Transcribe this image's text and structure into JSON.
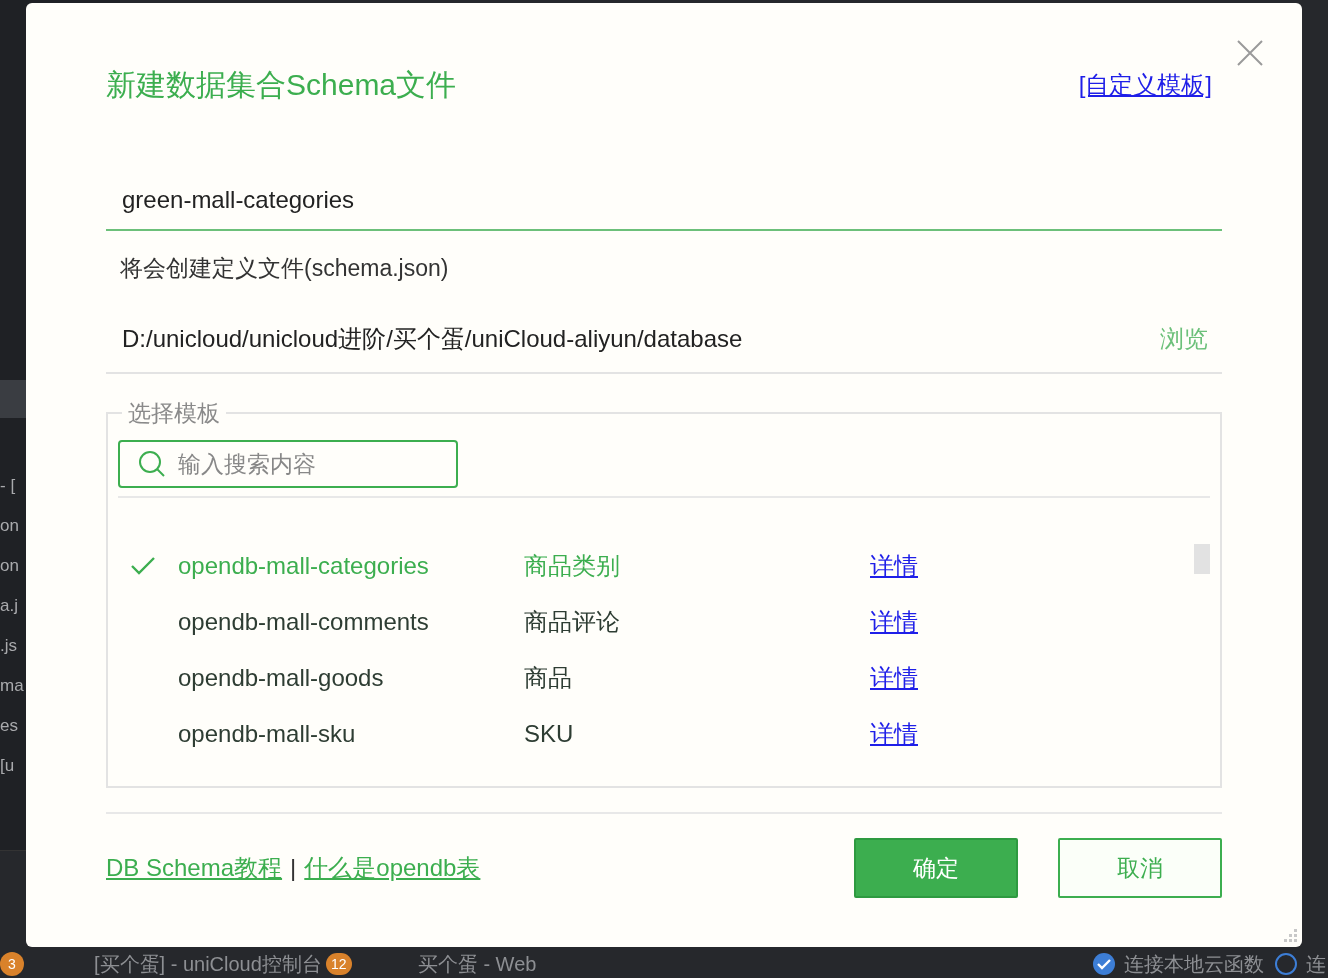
{
  "background": {
    "sidebar_lines": [
      "- [",
      "on",
      "on",
      "a.j",
      ".js",
      "ma",
      "es",
      "[u"
    ],
    "taskbar": {
      "left_badge": "3",
      "tabs": [
        {
          "label": "[买个蛋] - uniCloud控制台",
          "badge": "12"
        },
        {
          "label": "买个蛋 - Web"
        }
      ],
      "options": [
        {
          "label": "连接本地云函数",
          "kind": "checkbox",
          "checked": true
        },
        {
          "label": "连",
          "kind": "radio",
          "checked": false
        }
      ]
    }
  },
  "dialog": {
    "title": "新建数据集合Schema文件",
    "custom_template_link": "[自定义模板]",
    "name_field": {
      "value": "green-mall-categories"
    },
    "info_text": "将会创建定义文件(schema.json)",
    "path": {
      "value": "D:/unicloud/unicloud进阶/买个蛋/uniCloud-aliyun/database",
      "browse": "浏览"
    },
    "template_group": {
      "legend": "选择模板",
      "search": {
        "placeholder": "输入搜索内容"
      },
      "rows": [
        {
          "name": "opendb-mall-categories",
          "description": "商品类别",
          "link": "详情",
          "selected": true
        },
        {
          "name": "opendb-mall-comments",
          "description": "商品评论",
          "link": "详情",
          "selected": false
        },
        {
          "name": "opendb-mall-goods",
          "description": "商品",
          "link": "详情",
          "selected": false
        },
        {
          "name": "opendb-mall-sku",
          "description": "SKU",
          "link": "详情",
          "selected": false
        }
      ]
    },
    "footer_links": [
      "DB Schema教程",
      "什么是opendb表"
    ],
    "link_separator": "|",
    "buttons": [
      {
        "label": "确定",
        "kind": "primary"
      },
      {
        "label": "取消",
        "kind": "secondary"
      }
    ]
  }
}
